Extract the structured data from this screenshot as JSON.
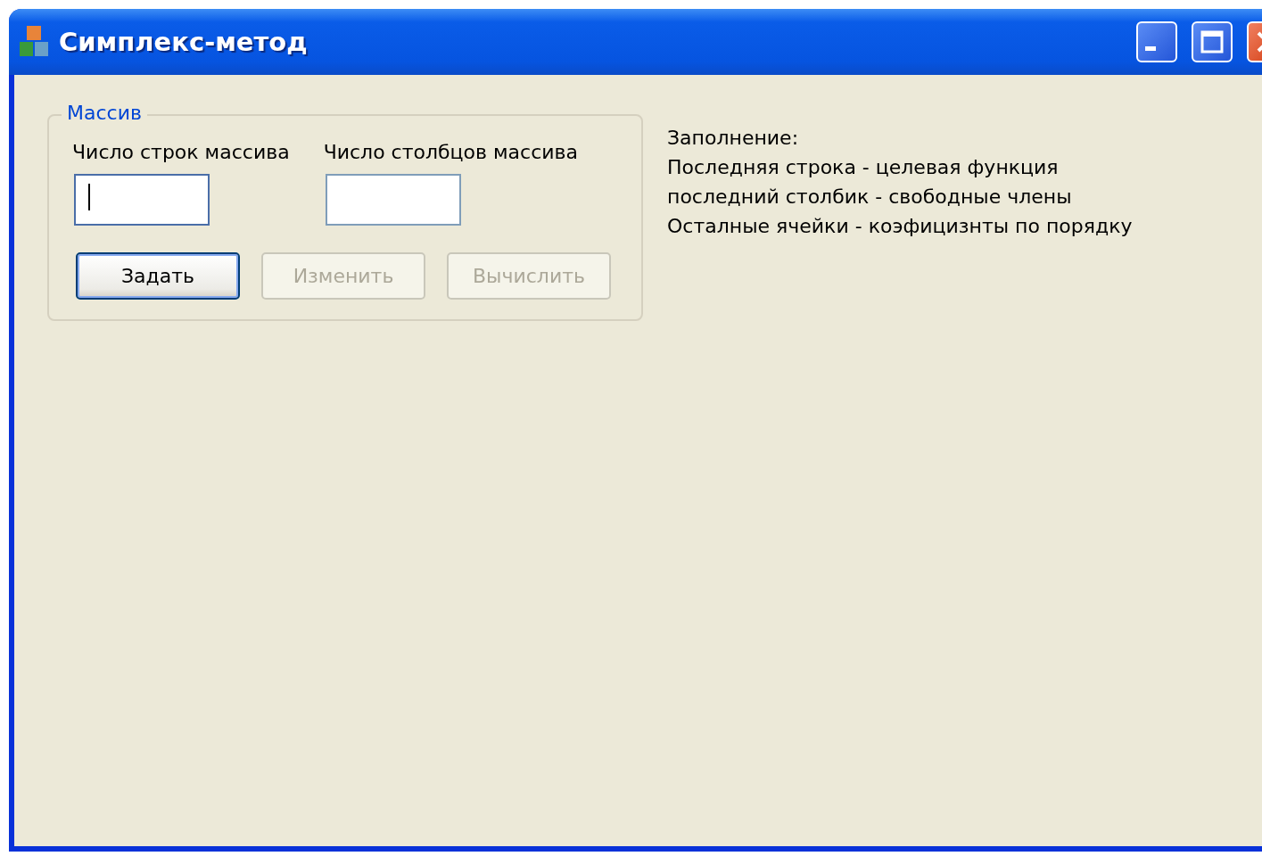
{
  "window": {
    "title": "Симплекс-метод"
  },
  "group": {
    "title": "Массив",
    "fields": [
      {
        "label": "Число строк массива",
        "focused": true
      },
      {
        "label": "Число столбцов массива",
        "focused": false
      }
    ],
    "buttons": [
      {
        "label": "Задать",
        "disabled": false,
        "default": true
      },
      {
        "label": "Изменить",
        "disabled": true,
        "default": false
      },
      {
        "label": "Вычислить",
        "disabled": true,
        "default": false
      }
    ]
  },
  "info": [
    "Заполнение:",
    "Последняя строка - целевая функция",
    "последний столбик - свободные члены",
    "Осталные ячейки - коэфицизнты по порядку"
  ]
}
